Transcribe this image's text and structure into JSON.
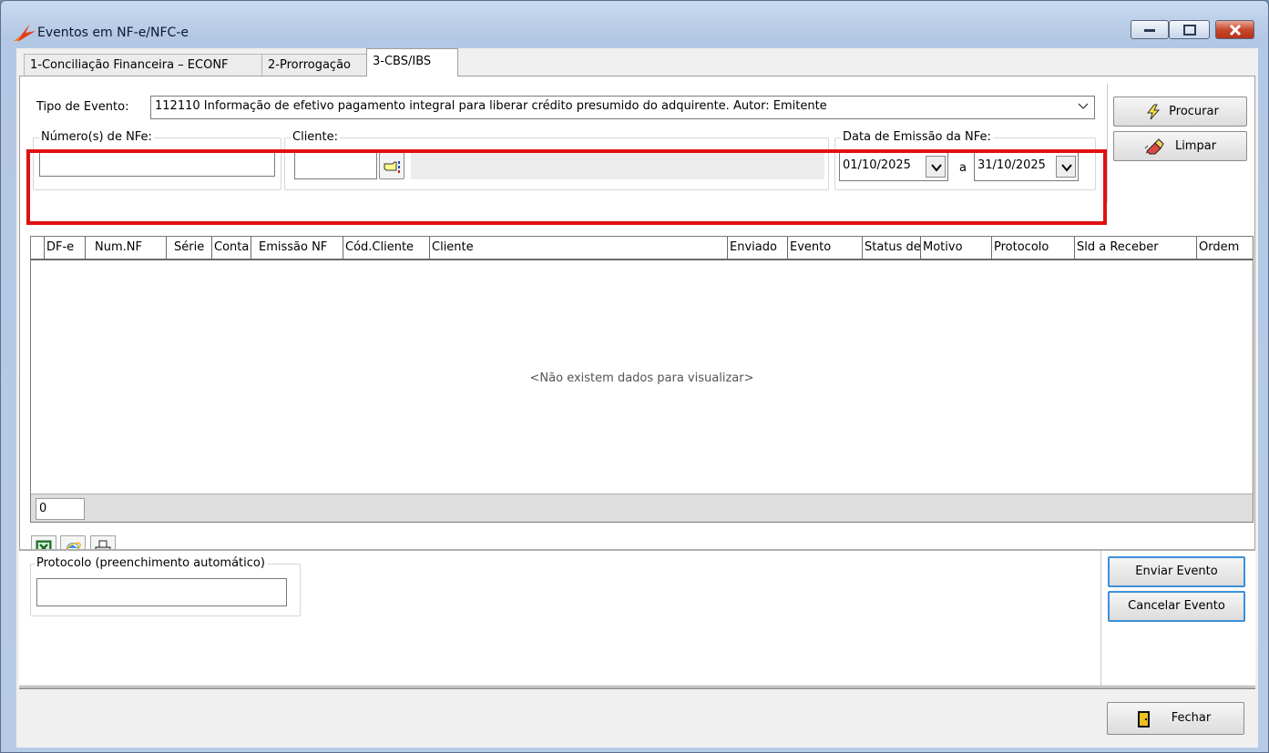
{
  "window": {
    "title": "Eventos em NF-e/NFC-e"
  },
  "tabs": [
    {
      "label": "1-Conciliação Financeira – ECONF"
    },
    {
      "label": "2-Prorrogação"
    },
    {
      "label": "3-CBS/IBS"
    }
  ],
  "form": {
    "tipo_evento_label": "Tipo de Evento:",
    "tipo_evento_value": "112110 Informação de efetivo pagamento integral para liberar crédito presumido do adquirente. Autor: Emitente",
    "numero_nfe_label": "Número(s) de NFe:",
    "numero_nfe_value": "",
    "cliente_label": "Cliente:",
    "cliente_value": "",
    "data_emissao_label": "Data de Emissão da NFe:",
    "data_inicio": "01/10/2025",
    "data_separator": "a",
    "data_fim": "31/10/2025"
  },
  "buttons": {
    "procurar": "Procurar",
    "limpar": "Limpar",
    "enviar_evento": "Enviar Evento",
    "cancelar_evento": "Cancelar Evento",
    "fechar": "Fechar"
  },
  "grid": {
    "columns": [
      "DF-e",
      "Num.NF",
      "Série",
      "Conta",
      "Emissão NF",
      "Cód.Cliente",
      "Cliente",
      "Enviado",
      "Evento",
      "Status de",
      "Motivo",
      "Protocolo",
      "Sld a Receber",
      "Ordem"
    ],
    "empty_message": "<Não existem dados para visualizar>",
    "row_count": "0"
  },
  "protocolo": {
    "label": "Protocolo (preenchimento automático)",
    "value": ""
  },
  "icons": {
    "app": "app-logo-icon",
    "procurar": "lightning-icon",
    "limpar": "eraser-icon",
    "cliente_lookup": "hand-pointer-icon",
    "excel": "excel-icon",
    "browser": "internet-explorer-icon",
    "print": "printer-icon",
    "fechar": "exit-door-icon"
  },
  "colors": {
    "highlight": "#e01010",
    "focus_border": "#3c8fd8"
  }
}
